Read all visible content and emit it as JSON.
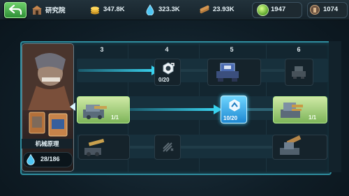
{
  "header": {
    "title": "研究院",
    "resources": [
      {
        "name": "gold",
        "icon": "gold-coins-icon",
        "value": "347.8K"
      },
      {
        "name": "water",
        "icon": "water-drop-icon",
        "value": "323.3K"
      },
      {
        "name": "wood",
        "icon": "wood-logs-icon",
        "value": "23.93K"
      },
      {
        "name": "gems",
        "icon": "green-gem-icon",
        "value": "1947"
      },
      {
        "name": "medals",
        "icon": "medal-icon",
        "value": "1074"
      }
    ]
  },
  "columns": [
    "3",
    "4",
    "5",
    "6"
  ],
  "unit": {
    "name": "机械原理",
    "count": "28/186"
  },
  "nodes": {
    "r1c4": "0/20",
    "r2c3": "1/1",
    "r2c5": "10/20",
    "r2c6": "1/1"
  },
  "colors": {
    "accent": "#2aa8bd",
    "active_line": "#35c8e6",
    "highlight": "#8fcf5d",
    "selected": "#2a9fe0"
  }
}
